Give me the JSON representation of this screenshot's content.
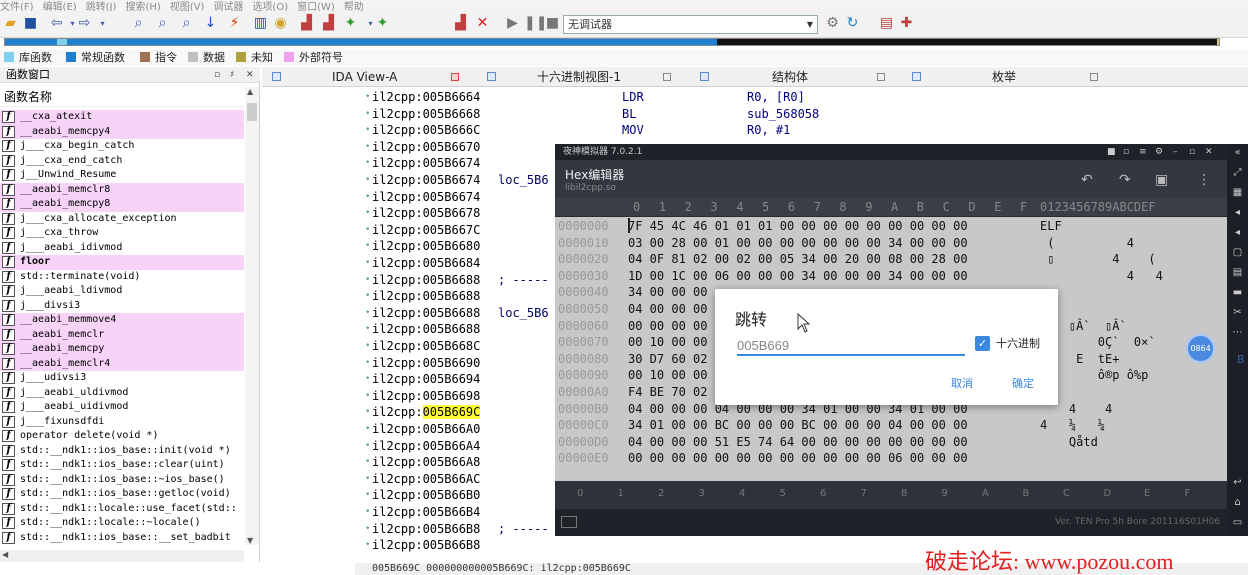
{
  "menu": [
    "文件(F)",
    "编辑(E)",
    "跳转(J)",
    "搜索(H)",
    "视图(V)",
    "调试器",
    "选项(O)",
    "窗口(W)",
    "帮助"
  ],
  "toolbar": {
    "debugger_select": "无调试器"
  },
  "legend": [
    {
      "label": "库函数",
      "color": "#80d0f0"
    },
    {
      "label": "常规函数",
      "color": "#2080d0"
    },
    {
      "label": "指令",
      "color": "#a07050"
    },
    {
      "label": "数据",
      "color": "#c0c0c0"
    },
    {
      "label": "未知",
      "color": "#b0a040"
    },
    {
      "label": "外部符号",
      "color": "#f0a0f0"
    }
  ],
  "func_panel": {
    "title": "函数窗口",
    "header": "函数名称",
    "items": [
      {
        "name": "__cxa_atexit",
        "lib": true
      },
      {
        "name": "__aeabi_memcpy4",
        "lib": true
      },
      {
        "name": "j___cxa_begin_catch",
        "lib": false
      },
      {
        "name": "j___cxa_end_catch",
        "lib": false
      },
      {
        "name": "j__Unwind_Resume",
        "lib": false
      },
      {
        "name": "__aeabi_memclr8",
        "lib": true
      },
      {
        "name": "__aeabi_memcpy8",
        "lib": true
      },
      {
        "name": "j___cxa_allocate_exception",
        "lib": false
      },
      {
        "name": "j___cxa_throw",
        "lib": false
      },
      {
        "name": "j___aeabi_idivmod",
        "lib": false
      },
      {
        "name": "floor",
        "lib": true
      },
      {
        "name": "std::terminate(void)",
        "lib": false
      },
      {
        "name": "j___aeabi_ldivmod",
        "lib": false
      },
      {
        "name": "j___divsi3",
        "lib": false
      },
      {
        "name": "__aeabi_memmove4",
        "lib": true
      },
      {
        "name": "__aeabi_memclr",
        "lib": true
      },
      {
        "name": "__aeabi_memcpy",
        "lib": true
      },
      {
        "name": "__aeabi_memclr4",
        "lib": true
      },
      {
        "name": "j___udivsi3",
        "lib": false
      },
      {
        "name": "j___aeabi_uldivmod",
        "lib": false
      },
      {
        "name": "j___aeabi_uidivmod",
        "lib": false
      },
      {
        "name": "j___fixunsdfdi",
        "lib": false
      },
      {
        "name": "operator delete(void *)",
        "lib": false
      },
      {
        "name": "std::__ndk1::ios_base::init(void *)",
        "lib": false
      },
      {
        "name": "std::__ndk1::ios_base::clear(uint)",
        "lib": false
      },
      {
        "name": "std::__ndk1::ios_base::~ios_base()",
        "lib": false
      },
      {
        "name": "std::__ndk1::ios_base::getloc(void)",
        "lib": false
      },
      {
        "name": "std::__ndk1::locale::use_facet(std::",
        "lib": false
      },
      {
        "name": "std::__ndk1::locale::~locale()",
        "lib": false
      },
      {
        "name": "std::__ndk1::ios_base::__set_badbit",
        "lib": false
      }
    ]
  },
  "tabs": [
    {
      "label": "IDA View-A"
    },
    {
      "label": "十六进制视图-1"
    },
    {
      "label": "结构体"
    },
    {
      "label": "枚举"
    }
  ],
  "code_lines": [
    {
      "addr": "il2cpp:005B6664",
      "label": "",
      "mnem": "LDR",
      "ops": "R0, [R0]"
    },
    {
      "addr": "il2cpp:005B6668",
      "label": "",
      "mnem": "BL",
      "ops": "sub_568058"
    },
    {
      "addr": "il2cpp:005B666C",
      "label": "",
      "mnem": "MOV",
      "ops": "R0, #1"
    },
    {
      "addr": "il2cpp:005B6670",
      "label": "",
      "mnem": "",
      "ops": ""
    },
    {
      "addr": "il2cpp:005B6674",
      "label": "",
      "mnem": "",
      "ops": ""
    },
    {
      "addr": "il2cpp:005B6674",
      "label": "loc_5B6",
      "mnem": "",
      "ops": ""
    },
    {
      "addr": "il2cpp:005B6674",
      "label": "",
      "mnem": "",
      "ops": ""
    },
    {
      "addr": "il2cpp:005B6678",
      "label": "",
      "mnem": "",
      "ops": ""
    },
    {
      "addr": "il2cpp:005B667C",
      "label": "",
      "mnem": "",
      "ops": ""
    },
    {
      "addr": "il2cpp:005B6680",
      "label": "",
      "mnem": "",
      "ops": ""
    },
    {
      "addr": "il2cpp:005B6684",
      "label": "",
      "mnem": "",
      "ops": ""
    },
    {
      "addr": "il2cpp:005B6688",
      "label": "; -----",
      "mnem": "",
      "ops": ""
    },
    {
      "addr": "il2cpp:005B6688",
      "label": "",
      "mnem": "",
      "ops": ""
    },
    {
      "addr": "il2cpp:005B6688",
      "label": "loc_5B6",
      "mnem": "",
      "ops": ""
    },
    {
      "addr": "il2cpp:005B6688",
      "label": "",
      "mnem": "",
      "ops": ""
    },
    {
      "addr": "il2cpp:005B668C",
      "label": "",
      "mnem": "",
      "ops": ""
    },
    {
      "addr": "il2cpp:005B6690",
      "label": "",
      "mnem": "",
      "ops": ""
    },
    {
      "addr": "il2cpp:005B6694",
      "label": "",
      "mnem": "",
      "ops": ""
    },
    {
      "addr": "il2cpp:005B6698",
      "label": "",
      "mnem": "",
      "ops": ""
    },
    {
      "addr_prefix": "il2cpp:",
      "addr_hl": "005B669C",
      "label": "",
      "mnem": "",
      "ops": ""
    },
    {
      "addr": "il2cpp:005B66A0",
      "label": "",
      "mnem": "",
      "ops": ""
    },
    {
      "addr": "il2cpp:005B66A4",
      "label": "",
      "mnem": "",
      "ops": ""
    },
    {
      "addr": "il2cpp:005B66A8",
      "label": "",
      "mnem": "",
      "ops": ""
    },
    {
      "addr": "il2cpp:005B66AC",
      "label": "",
      "mnem": "",
      "ops": ""
    },
    {
      "addr": "il2cpp:005B66B0",
      "label": "",
      "mnem": "",
      "ops": ""
    },
    {
      "addr": "il2cpp:005B66B4",
      "label": "",
      "mnem": "",
      "ops": ""
    },
    {
      "addr": "il2cpp:005B66B8",
      "label": "; -----",
      "mnem": "",
      "ops": ""
    },
    {
      "addr": "il2cpp:005B66B8",
      "label": "",
      "mnem": "",
      "ops": ""
    }
  ],
  "statusbar": "005B669C 000000000005B669C: il2cpp:005B669C",
  "emulator": {
    "title": "夜神模拟器 7.0.2.1",
    "app_title": "Hex编辑器",
    "app_subtitle": "libil2cpp.so",
    "hex_header_cols": [
      "0",
      "1",
      "2",
      "3",
      "4",
      "5",
      "6",
      "7",
      "8",
      "9",
      "A",
      "B",
      "C",
      "D",
      "E",
      "F"
    ],
    "ascii_header": "0123456789ABCDEF",
    "rows": [
      {
        "off": "0000000",
        "bytes": "7F 45 4C 46 01 01 01 00 00 00 00 00 00 00 00 00",
        "ascii": "ELF"
      },
      {
        "off": "0000010",
        "bytes": "03 00 28 00 01 00 00 00 00 00 00 00 34 00 00 00",
        "ascii": " (          4"
      },
      {
        "off": "0000020",
        "bytes": "04 0F 81 02 00 02 00 05 34 00 20 00 08 00 28 00",
        "ascii": " ▯        4    ("
      },
      {
        "off": "0000030",
        "bytes": "1D 00 1C 00 06 00 00 00 34 00 00 00 34 00 00 00",
        "ascii": "            4   4"
      },
      {
        "off": "0000040",
        "bytes": "34 00 00 00",
        "ascii": ""
      },
      {
        "off": "0000050",
        "bytes": "04 00 00 00",
        "ascii": ""
      },
      {
        "off": "0000060",
        "bytes": "00 00 00 00",
        "ascii": "    ▯Â`  ▯Â`"
      },
      {
        "off": "0000070",
        "bytes": "00 10 00 00",
        "ascii": "        0Ç`  0×`"
      },
      {
        "off": "0000080",
        "bytes": "30 D7 60 02",
        "ascii": " `   E  tE+"
      },
      {
        "off": "0000090",
        "bytes": "00 10 00 00",
        "ascii": "        ô®p ô%p"
      },
      {
        "off": "00000A0",
        "bytes": "F4 BE 70 02",
        "ascii": "p"
      },
      {
        "off": "00000B0",
        "bytes": "04 00 00 00 04 00 00 00 34 01 00 00 34 01 00 00",
        "ascii": "    4    4"
      },
      {
        "off": "00000C0",
        "bytes": "34 01 00 00 BC 00 00 00 BC 00 00 00 04 00 00 00",
        "ascii": "4   ¼   ¼"
      },
      {
        "off": "00000D0",
        "bytes": "04 00 00 00 51 E5 74 64 00 00 00 00 00 00 00 00",
        "ascii": "    Qåtd"
      },
      {
        "off": "00000E0",
        "bytes": "00 00 00 00 00 00 00 00 00 00 00 00 06 00 00 00",
        "ascii": ""
      }
    ],
    "footer_cols": [
      "0",
      "1",
      "2",
      "3",
      "4",
      "5",
      "6",
      "7",
      "8",
      "9",
      "A",
      "B",
      "C",
      "D",
      "E",
      "F"
    ],
    "version": "Ver. TEN Pro 5h Bore 201116S01H06",
    "ball": "0864"
  },
  "dialog": {
    "title": "跳转",
    "input_value": "005B669",
    "hex_label": "十六进制",
    "cancel": "取消",
    "ok": "确定"
  },
  "watermark": "破走论坛: www.pozou.com",
  "right_edge_char": "B"
}
